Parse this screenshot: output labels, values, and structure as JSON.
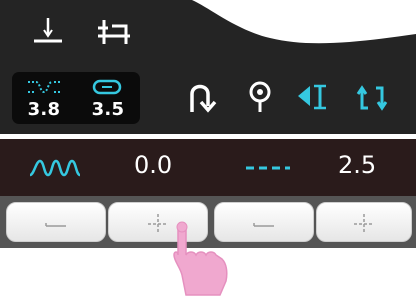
{
  "header": {
    "icons": [
      "presser-foot-icon",
      "feed-dog-icon"
    ]
  },
  "value_box": {
    "left": {
      "icon": "stitch-width-icon",
      "value": "3.8"
    },
    "right": {
      "icon": "stitch-length-icon",
      "value": "3.5"
    }
  },
  "controls": [
    "reverse-stitch-icon",
    "needle-position-icon",
    "mirror-left-icon",
    "mirror-flip-icon"
  ],
  "adjust_row": {
    "left": {
      "icon": "zigzag-stitch-icon",
      "value": "0.0"
    },
    "right": {
      "icon": "straight-stitch-icon",
      "value": "2.5"
    }
  },
  "buttons": [
    {
      "icon": "minus-icon"
    },
    {
      "icon": "plus-icon"
    },
    {
      "icon": "minus-icon"
    },
    {
      "icon": "plus-icon"
    }
  ],
  "colors": {
    "panel_dark": "#242424",
    "row_dark": "#2a1b1b",
    "accent_cyan": "#35c8e0",
    "text_white": "#ffffff",
    "pointer_pink": "#f0a8cf"
  }
}
